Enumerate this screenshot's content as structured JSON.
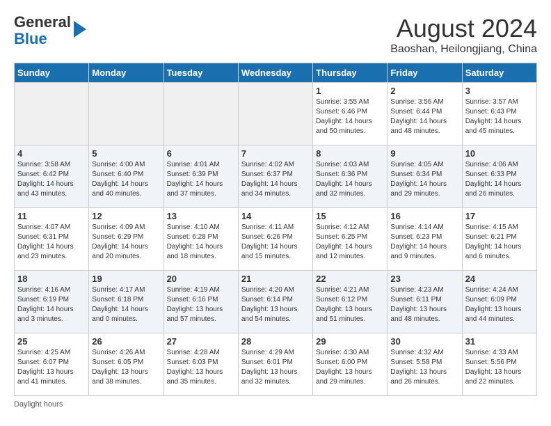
{
  "header": {
    "logo_general": "General",
    "logo_blue": "Blue",
    "month_year": "August 2024",
    "location": "Baoshan, Heilongjiang, China"
  },
  "days_of_week": [
    "Sunday",
    "Monday",
    "Tuesday",
    "Wednesday",
    "Thursday",
    "Friday",
    "Saturday"
  ],
  "footnote": "Daylight hours",
  "weeks": [
    [
      {
        "day": "",
        "sunrise": "",
        "sunset": "",
        "daylight": "",
        "empty": true
      },
      {
        "day": "",
        "sunrise": "",
        "sunset": "",
        "daylight": "",
        "empty": true
      },
      {
        "day": "",
        "sunrise": "",
        "sunset": "",
        "daylight": "",
        "empty": true
      },
      {
        "day": "",
        "sunrise": "",
        "sunset": "",
        "daylight": "",
        "empty": true
      },
      {
        "day": "1",
        "sunrise": "Sunrise: 3:55 AM",
        "sunset": "Sunset: 6:46 PM",
        "daylight": "Daylight: 14 hours and 50 minutes.",
        "empty": false
      },
      {
        "day": "2",
        "sunrise": "Sunrise: 3:56 AM",
        "sunset": "Sunset: 6:44 PM",
        "daylight": "Daylight: 14 hours and 48 minutes.",
        "empty": false
      },
      {
        "day": "3",
        "sunrise": "Sunrise: 3:57 AM",
        "sunset": "Sunset: 6:43 PM",
        "daylight": "Daylight: 14 hours and 45 minutes.",
        "empty": false
      }
    ],
    [
      {
        "day": "4",
        "sunrise": "Sunrise: 3:58 AM",
        "sunset": "Sunset: 6:42 PM",
        "daylight": "Daylight: 14 hours and 43 minutes.",
        "empty": false
      },
      {
        "day": "5",
        "sunrise": "Sunrise: 4:00 AM",
        "sunset": "Sunset: 6:40 PM",
        "daylight": "Daylight: 14 hours and 40 minutes.",
        "empty": false
      },
      {
        "day": "6",
        "sunrise": "Sunrise: 4:01 AM",
        "sunset": "Sunset: 6:39 PM",
        "daylight": "Daylight: 14 hours and 37 minutes.",
        "empty": false
      },
      {
        "day": "7",
        "sunrise": "Sunrise: 4:02 AM",
        "sunset": "Sunset: 6:37 PM",
        "daylight": "Daylight: 14 hours and 34 minutes.",
        "empty": false
      },
      {
        "day": "8",
        "sunrise": "Sunrise: 4:03 AM",
        "sunset": "Sunset: 6:36 PM",
        "daylight": "Daylight: 14 hours and 32 minutes.",
        "empty": false
      },
      {
        "day": "9",
        "sunrise": "Sunrise: 4:05 AM",
        "sunset": "Sunset: 6:34 PM",
        "daylight": "Daylight: 14 hours and 29 minutes.",
        "empty": false
      },
      {
        "day": "10",
        "sunrise": "Sunrise: 4:06 AM",
        "sunset": "Sunset: 6:33 PM",
        "daylight": "Daylight: 14 hours and 26 minutes.",
        "empty": false
      }
    ],
    [
      {
        "day": "11",
        "sunrise": "Sunrise: 4:07 AM",
        "sunset": "Sunset: 6:31 PM",
        "daylight": "Daylight: 14 hours and 23 minutes.",
        "empty": false
      },
      {
        "day": "12",
        "sunrise": "Sunrise: 4:09 AM",
        "sunset": "Sunset: 6:29 PM",
        "daylight": "Daylight: 14 hours and 20 minutes.",
        "empty": false
      },
      {
        "day": "13",
        "sunrise": "Sunrise: 4:10 AM",
        "sunset": "Sunset: 6:28 PM",
        "daylight": "Daylight: 14 hours and 18 minutes.",
        "empty": false
      },
      {
        "day": "14",
        "sunrise": "Sunrise: 4:11 AM",
        "sunset": "Sunset: 6:26 PM",
        "daylight": "Daylight: 14 hours and 15 minutes.",
        "empty": false
      },
      {
        "day": "15",
        "sunrise": "Sunrise: 4:12 AM",
        "sunset": "Sunset: 6:25 PM",
        "daylight": "Daylight: 14 hours and 12 minutes.",
        "empty": false
      },
      {
        "day": "16",
        "sunrise": "Sunrise: 4:14 AM",
        "sunset": "Sunset: 6:23 PM",
        "daylight": "Daylight: 14 hours and 9 minutes.",
        "empty": false
      },
      {
        "day": "17",
        "sunrise": "Sunrise: 4:15 AM",
        "sunset": "Sunset: 6:21 PM",
        "daylight": "Daylight: 14 hours and 6 minutes.",
        "empty": false
      }
    ],
    [
      {
        "day": "18",
        "sunrise": "Sunrise: 4:16 AM",
        "sunset": "Sunset: 6:19 PM",
        "daylight": "Daylight: 14 hours and 3 minutes.",
        "empty": false
      },
      {
        "day": "19",
        "sunrise": "Sunrise: 4:17 AM",
        "sunset": "Sunset: 6:18 PM",
        "daylight": "Daylight: 14 hours and 0 minutes.",
        "empty": false
      },
      {
        "day": "20",
        "sunrise": "Sunrise: 4:19 AM",
        "sunset": "Sunset: 6:16 PM",
        "daylight": "Daylight: 13 hours and 57 minutes.",
        "empty": false
      },
      {
        "day": "21",
        "sunrise": "Sunrise: 4:20 AM",
        "sunset": "Sunset: 6:14 PM",
        "daylight": "Daylight: 13 hours and 54 minutes.",
        "empty": false
      },
      {
        "day": "22",
        "sunrise": "Sunrise: 4:21 AM",
        "sunset": "Sunset: 6:12 PM",
        "daylight": "Daylight: 13 hours and 51 minutes.",
        "empty": false
      },
      {
        "day": "23",
        "sunrise": "Sunrise: 4:23 AM",
        "sunset": "Sunset: 6:11 PM",
        "daylight": "Daylight: 13 hours and 48 minutes.",
        "empty": false
      },
      {
        "day": "24",
        "sunrise": "Sunrise: 4:24 AM",
        "sunset": "Sunset: 6:09 PM",
        "daylight": "Daylight: 13 hours and 44 minutes.",
        "empty": false
      }
    ],
    [
      {
        "day": "25",
        "sunrise": "Sunrise: 4:25 AM",
        "sunset": "Sunset: 6:07 PM",
        "daylight": "Daylight: 13 hours and 41 minutes.",
        "empty": false
      },
      {
        "day": "26",
        "sunrise": "Sunrise: 4:26 AM",
        "sunset": "Sunset: 6:05 PM",
        "daylight": "Daylight: 13 hours and 38 minutes.",
        "empty": false
      },
      {
        "day": "27",
        "sunrise": "Sunrise: 4:28 AM",
        "sunset": "Sunset: 6:03 PM",
        "daylight": "Daylight: 13 hours and 35 minutes.",
        "empty": false
      },
      {
        "day": "28",
        "sunrise": "Sunrise: 4:29 AM",
        "sunset": "Sunset: 6:01 PM",
        "daylight": "Daylight: 13 hours and 32 minutes.",
        "empty": false
      },
      {
        "day": "29",
        "sunrise": "Sunrise: 4:30 AM",
        "sunset": "Sunset: 6:00 PM",
        "daylight": "Daylight: 13 hours and 29 minutes.",
        "empty": false
      },
      {
        "day": "30",
        "sunrise": "Sunrise: 4:32 AM",
        "sunset": "Sunset: 5:58 PM",
        "daylight": "Daylight: 13 hours and 26 minutes.",
        "empty": false
      },
      {
        "day": "31",
        "sunrise": "Sunrise: 4:33 AM",
        "sunset": "Sunset: 5:56 PM",
        "daylight": "Daylight: 13 hours and 22 minutes.",
        "empty": false
      }
    ]
  ]
}
